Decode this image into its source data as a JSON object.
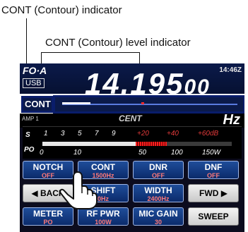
{
  "annotations": {
    "cont_indicator_label": "CONT (Contour) indicator",
    "cont_level_label": "CONT (Contour) level indicator"
  },
  "display": {
    "vfo_label": "FO·A",
    "mode": "USB",
    "clock": "14:46Z",
    "frequency_main": "14.195",
    "frequency_sub": "00",
    "amp_label": "AMP 1",
    "center_text": "CENT",
    "unit": "Hz"
  },
  "cont_bar": {
    "indicator_label": "CONT",
    "level_fraction": 0.45
  },
  "meter": {
    "s_label": "S",
    "po_label": "PO",
    "s_scale": [
      "1",
      "3",
      "5",
      "7",
      "9",
      "+20",
      "+40",
      "+60dB"
    ],
    "po_scale": [
      "0",
      "10",
      "50",
      "100",
      "150W"
    ]
  },
  "buttons": {
    "notch": {
      "label": "NOTCH",
      "value": "OFF"
    },
    "cont": {
      "label": "CONT",
      "value": "1500Hz"
    },
    "dnr": {
      "label": "DNR",
      "value": "OFF"
    },
    "dnf": {
      "label": "DNF",
      "value": "OFF"
    },
    "back": {
      "label": "BACK"
    },
    "shift": {
      "label": "SHIFT",
      "value": "0Hz"
    },
    "width": {
      "label": "WIDTH",
      "value": "2400Hz"
    },
    "fwd": {
      "label": "FWD"
    },
    "meter": {
      "label": "METER",
      "value": "PO"
    },
    "rf_pwr": {
      "label": "RF PWR",
      "value": "100W"
    },
    "mic_gain": {
      "label": "MIC GAIN",
      "value": "30"
    },
    "sweep": {
      "label": "SWEEP"
    }
  },
  "colors": {
    "screen_bg": "#0c0c1e",
    "button_blue": "#0b2b6b",
    "button_value": "#ff7a7a",
    "indicator_frame": "#0a1d6b",
    "peak_red": "#ff1e1e"
  }
}
